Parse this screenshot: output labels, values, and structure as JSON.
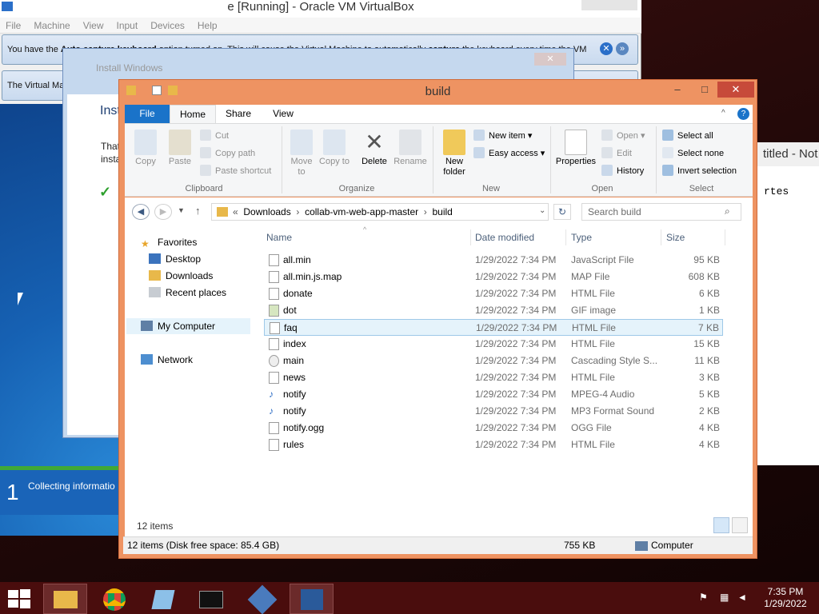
{
  "vbox": {
    "title": "e [Running] - Oracle VM VirtualBox",
    "menu": [
      "File",
      "Machine",
      "View",
      "Input",
      "Devices",
      "Help"
    ],
    "notice1_a": "You have the ",
    "notice1_b": "Auto capture keyboard",
    "notice1_c": " option turned on. This will cause the Virtual Machine to automatically ",
    "notice1_d": "capture",
    "notice1_e": " the keyboard every time the VM",
    "notice2": "The Virtual Machine reports th",
    "guest": {
      "install_title": "Install Windows",
      "inst_heading": "Inst",
      "that_text": "That",
      "insta_text": "insta",
      "step_number": "1",
      "step_text": "Collecting informatio"
    }
  },
  "notepad": {
    "title": "titled - Not",
    "text": "rtes"
  },
  "explorer": {
    "title": "build",
    "tabs": [
      "File",
      "Home",
      "Share",
      "View"
    ],
    "ribbon": {
      "clipboard": {
        "copy": "Copy",
        "paste": "Paste",
        "cut": "Cut",
        "copy_path": "Copy path",
        "paste_shortcut": "Paste shortcut",
        "group": "Clipboard"
      },
      "organize": {
        "move_to": "Move to",
        "copy_to": "Copy to",
        "delete": "Delete",
        "rename": "Rename",
        "group": "Organize"
      },
      "new": {
        "new_folder": "New folder",
        "new_item": "New item",
        "easy_access": "Easy access",
        "group": "New"
      },
      "open": {
        "properties": "Properties",
        "open": "Open",
        "edit": "Edit",
        "history": "History",
        "group": "Open"
      },
      "select": {
        "select_all": "Select all",
        "select_none": "Select none",
        "invert_selection": "Invert selection",
        "group": "Select"
      }
    },
    "address": {
      "sep": "«",
      "crumbs": [
        "Downloads",
        "collab-vm-web-app-master",
        "build"
      ],
      "search_placeholder": "Search build"
    },
    "nav": {
      "favorites": "Favorites",
      "desktop": "Desktop",
      "downloads": "Downloads",
      "recent": "Recent places",
      "computer": "My Computer",
      "network": "Network"
    },
    "columns": {
      "name": "Name",
      "date": "Date modified",
      "type": "Type",
      "size": "Size"
    },
    "files": [
      {
        "name": "all.min",
        "date": "1/29/2022 7:34 PM",
        "type": "JavaScript File",
        "size": "95 KB"
      },
      {
        "name": "all.min.js.map",
        "date": "1/29/2022 7:34 PM",
        "type": "MAP File",
        "size": "608 KB"
      },
      {
        "name": "donate",
        "date": "1/29/2022 7:34 PM",
        "type": "HTML File",
        "size": "6 KB"
      },
      {
        "name": "dot",
        "date": "1/29/2022 7:34 PM",
        "type": "GIF image",
        "size": "1 KB"
      },
      {
        "name": "faq",
        "date": "1/29/2022 7:34 PM",
        "type": "HTML File",
        "size": "7 KB"
      },
      {
        "name": "index",
        "date": "1/29/2022 7:34 PM",
        "type": "HTML File",
        "size": "15 KB"
      },
      {
        "name": "main",
        "date": "1/29/2022 7:34 PM",
        "type": "Cascading Style S...",
        "size": "11 KB"
      },
      {
        "name": "news",
        "date": "1/29/2022 7:34 PM",
        "type": "HTML File",
        "size": "3 KB"
      },
      {
        "name": "notify",
        "date": "1/29/2022 7:34 PM",
        "type": "MPEG-4 Audio",
        "size": "5 KB"
      },
      {
        "name": "notify",
        "date": "1/29/2022 7:34 PM",
        "type": "MP3 Format Sound",
        "size": "2 KB"
      },
      {
        "name": "notify.ogg",
        "date": "1/29/2022 7:34 PM",
        "type": "OGG File",
        "size": "4 KB"
      },
      {
        "name": "rules",
        "date": "1/29/2022 7:34 PM",
        "type": "HTML File",
        "size": "4 KB"
      }
    ],
    "item_count": "12 items",
    "status": {
      "left": "12 items (Disk free space: 85.4 GB)",
      "size": "755 KB",
      "location": "Computer"
    }
  },
  "taskbar": {
    "time": "7:35 PM",
    "date": "1/29/2022"
  }
}
